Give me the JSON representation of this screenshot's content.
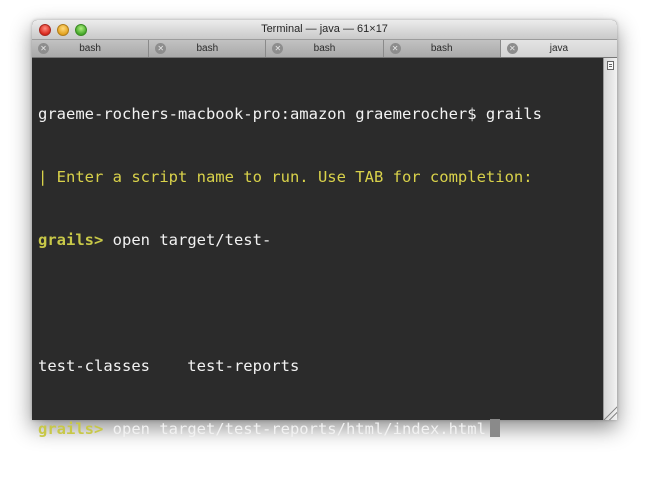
{
  "window": {
    "title": "Terminal — java — 61×17"
  },
  "tabs": [
    {
      "label": "bash",
      "active": false
    },
    {
      "label": "bash",
      "active": false
    },
    {
      "label": "bash",
      "active": false
    },
    {
      "label": "bash",
      "active": false
    },
    {
      "label": "java",
      "active": true
    }
  ],
  "terminal": {
    "line1": "graeme-rochers-macbook-pro:amazon graemerocher$ grails",
    "line2": "| Enter a script name to run. Use TAB for completion:",
    "line3_prompt": "grails>",
    "line3_cmd": " open target/test-",
    "line4": "",
    "line5": "test-classes    test-reports",
    "line6_prompt": "grails>",
    "line6_cmd": " open target/test-reports/html/index.html"
  },
  "colors": {
    "background": "#2b2b2b",
    "text": "#f2f2f2",
    "prompt": "#c8c848"
  }
}
